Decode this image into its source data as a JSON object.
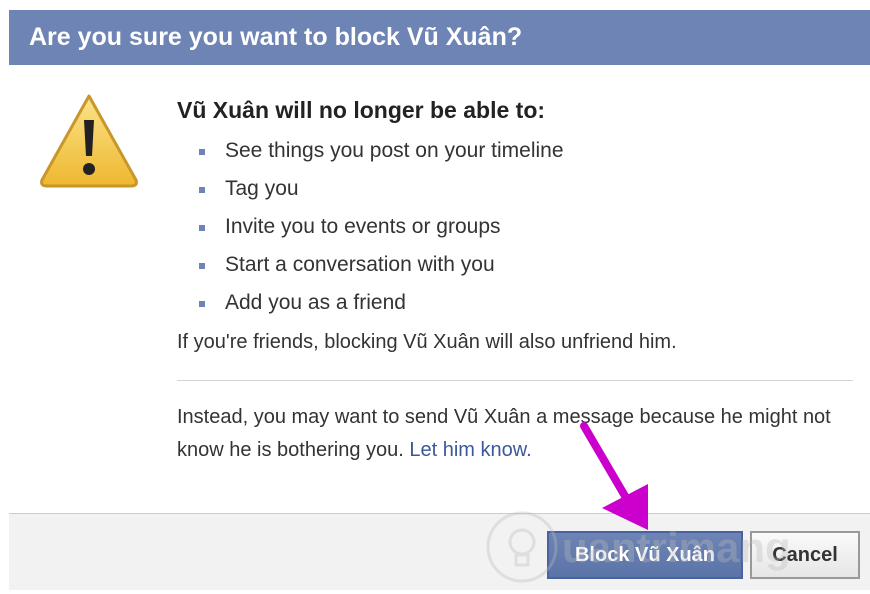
{
  "dialog": {
    "title": "Are you sure you want to block Vũ Xuân?",
    "heading": "Vũ Xuân will no longer be able to:",
    "restrictions": [
      "See things you post on your timeline",
      "Tag you",
      "Invite you to events or groups",
      "Start a conversation with you",
      "Add you as a friend"
    ],
    "friend_note": "If you're friends, blocking Vũ Xuân will also unfriend him.",
    "alternative_text": "Instead, you may want to send Vũ Xuân a message because he might not know he is bothering you.",
    "alternative_link": "Let him know."
  },
  "footer": {
    "block_button": "Block Vũ Xuân",
    "cancel_button": "Cancel"
  },
  "watermark": {
    "text": "uantrimang"
  },
  "colors": {
    "title_bar": "#6d84b4",
    "link": "#3b5998",
    "warning_fill": "#f4c84a",
    "arrow": "#cc00cc"
  }
}
